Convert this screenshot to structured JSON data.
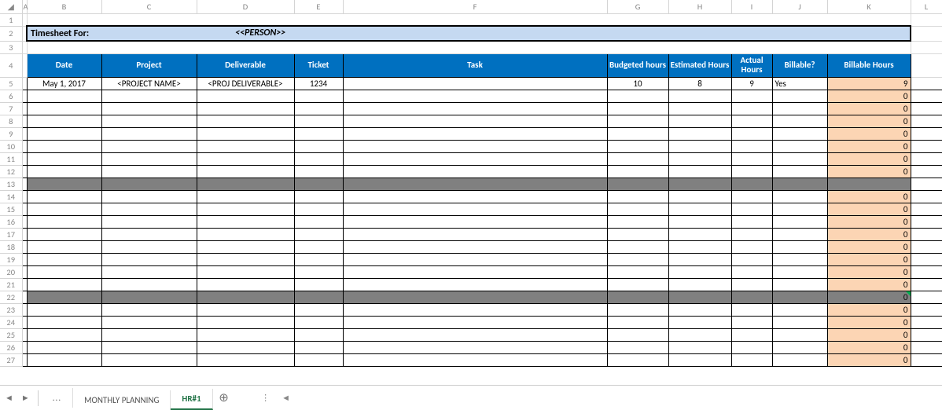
{
  "columns": [
    "A",
    "B",
    "C",
    "D",
    "E",
    "F",
    "G",
    "H",
    "I",
    "J",
    "K",
    "L"
  ],
  "row_numbers": [
    1,
    2,
    3,
    4,
    5,
    6,
    7,
    8,
    9,
    10,
    11,
    12,
    13,
    14,
    15,
    16,
    17,
    18,
    19,
    20,
    21,
    22,
    23,
    24,
    25,
    26,
    27
  ],
  "title_row": {
    "label": "Timesheet For:",
    "person": "<<PERSON>>"
  },
  "headers": {
    "B": "Date",
    "C": "Project",
    "D": "Deliverable",
    "E": "Ticket",
    "F": "Task",
    "G": "Budgeted hours",
    "H": "Estimated Hours",
    "I": "Actual Hours",
    "J": "Billable?",
    "K": "Billable Hours"
  },
  "data_rows": {
    "5": {
      "B": "May 1, 2017",
      "C": "<PROJECT NAME>",
      "D": "<PROJ DELIVERABLE>",
      "E": "1234",
      "F": "",
      "G": "10",
      "H": "8",
      "I": "9",
      "J": "Yes",
      "K": "9"
    },
    "6": {
      "K": "0"
    },
    "7": {
      "K": "0"
    },
    "8": {
      "K": "0"
    },
    "9": {
      "K": "0"
    },
    "10": {
      "K": "0"
    },
    "11": {
      "K": "0"
    },
    "12": {
      "K": "0"
    },
    "14": {
      "K": "0"
    },
    "15": {
      "K": "0"
    },
    "16": {
      "K": "0"
    },
    "17": {
      "K": "0"
    },
    "18": {
      "K": "0"
    },
    "19": {
      "K": "0"
    },
    "20": {
      "K": "0"
    },
    "21": {
      "K": "0"
    },
    "23": {
      "K": "0"
    },
    "24": {
      "K": "0"
    },
    "25": {
      "K": "0"
    },
    "26": {
      "K": "0"
    },
    "27": {
      "K": "0"
    }
  },
  "grey_rows": {
    "13": {
      "K": ""
    },
    "22": {
      "K": "0",
      "indicator": true
    }
  },
  "tabs": {
    "overflow": "...",
    "items": [
      {
        "label": "MONTHLY PLANNING",
        "active": false
      },
      {
        "label": "HR#1",
        "active": true
      }
    ],
    "add_icon": "⊕",
    "nav_prev": "◄",
    "nav_next": "►",
    "scroll_left": "◄",
    "scroll_sep": "⋮"
  }
}
